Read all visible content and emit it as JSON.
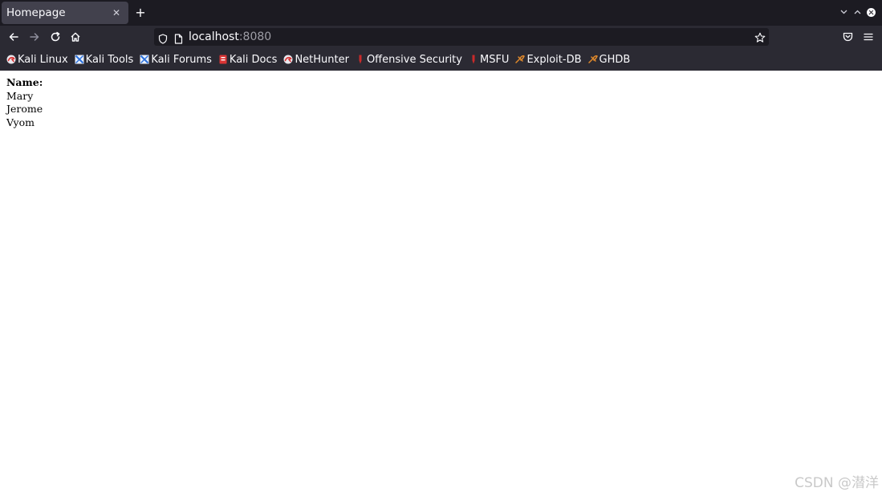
{
  "tab": {
    "title": "Homepage",
    "close_icon": "close-icon",
    "new_tab_icon": "plus-icon"
  },
  "window": {
    "controls": [
      "chevron-down-icon",
      "chevron-up-icon",
      "close-circle-icon"
    ]
  },
  "nav": {
    "back_icon": "arrow-left-icon",
    "forward_icon": "arrow-right-icon",
    "reload_icon": "reload-icon",
    "home_icon": "home-icon",
    "url_host": "localhost",
    "url_port": ":8080",
    "shield_icon": "shield-icon",
    "page_icon": "page-icon",
    "star_icon": "star-icon",
    "pocket_icon": "pocket-icon",
    "menu_icon": "hamburger-menu-icon"
  },
  "bookmarks": [
    {
      "label": "Kali Linux",
      "icon": "kali-dragon-icon"
    },
    {
      "label": "Kali Tools",
      "icon": "kali-tools-icon"
    },
    {
      "label": "Kali Forums",
      "icon": "kali-forums-icon"
    },
    {
      "label": "Kali Docs",
      "icon": "kali-docs-icon"
    },
    {
      "label": "NetHunter",
      "icon": "nethunter-icon"
    },
    {
      "label": "Offensive Security",
      "icon": "offsec-icon"
    },
    {
      "label": "MSFU",
      "icon": "msfu-icon"
    },
    {
      "label": "Exploit-DB",
      "icon": "exploit-db-icon"
    },
    {
      "label": "GHDB",
      "icon": "ghdb-icon"
    }
  ],
  "page": {
    "label": "Name:",
    "names": [
      "Mary",
      "Jerome",
      "Vyom"
    ]
  },
  "watermark": "CSDN @潜洋",
  "colors": {
    "tabstrip_bg": "#1c1b22",
    "toolbar_bg": "#2b2a33",
    "active_tab_bg": "#42414d",
    "urlbar_bg": "#1c1b22",
    "text_light": "#fbfbfe"
  }
}
